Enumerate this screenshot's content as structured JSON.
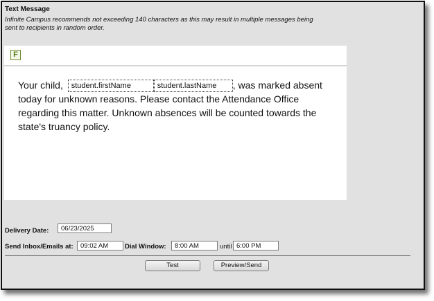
{
  "section_title": "Text Message",
  "notice": "Infinite Campus recommends not exceeding 140 characters as this may result in multiple messages being sent to recipients in random order.",
  "editor": {
    "format_icon": "F",
    "text_before": "Your child, ",
    "token_first": "student.firstName",
    "token_last": "student.lastName",
    "text_after": ", was marked absent today for unknown reasons. Please contact the Attendance Office regarding this matter. Unknown absences will be counted towards the state's truancy policy."
  },
  "delivery": {
    "date_label": "Delivery Date:",
    "date_value": "06/23/2025",
    "send_label": "Send Inbox/Emails at:",
    "send_value": "09:02 AM",
    "dial_label": "Dial Window:",
    "dial_start": "8:00 AM",
    "until_label": "until",
    "dial_end": "6:00 PM"
  },
  "buttons": {
    "test": "Test",
    "preview_send": "Preview/Send"
  }
}
